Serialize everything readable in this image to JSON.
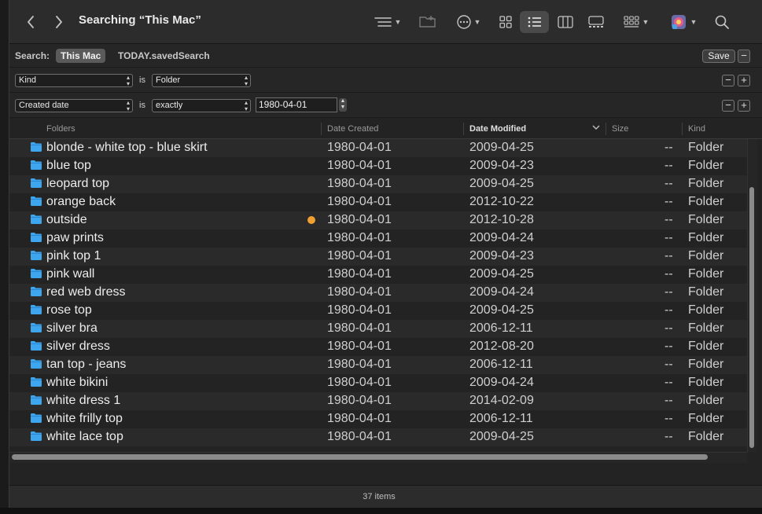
{
  "window": {
    "title": "Searching “This Mac”"
  },
  "toolbar": {
    "icons": [
      "back-chevron-icon",
      "forward-chevron-icon",
      "list-group-icon",
      "new-folder-icon",
      "more-actions-icon",
      "icon-view-icon",
      "list-view-icon",
      "column-view-icon",
      "gallery-view-icon",
      "group-by-icon",
      "app-tag-icon",
      "search-icon"
    ]
  },
  "search": {
    "label": "Search:",
    "scope_selected": "This Mac",
    "scope_other": "TODAY.savedSearch",
    "save_label": "Save",
    "remove_label": "−"
  },
  "criteria": [
    {
      "attribute": "Kind",
      "operator_label": "is",
      "value": "Folder"
    },
    {
      "attribute": "Created date",
      "operator_label": "is",
      "value": "exactly",
      "date": "1980-04-01"
    }
  ],
  "columns": {
    "name": "Folders",
    "created": "Date Created",
    "modified": "Date Modified",
    "size": "Size",
    "kind": "Kind"
  },
  "rows": [
    {
      "name": "blonde - white top - blue skirt",
      "created": "1980-04-01",
      "modified": "2009-04-25",
      "size": "--",
      "kind": "Folder"
    },
    {
      "name": "blue top",
      "created": "1980-04-01",
      "modified": "2009-04-23",
      "size": "--",
      "kind": "Folder"
    },
    {
      "name": "leopard top",
      "created": "1980-04-01",
      "modified": "2009-04-25",
      "size": "--",
      "kind": "Folder"
    },
    {
      "name": "orange back",
      "created": "1980-04-01",
      "modified": "2012-10-22",
      "size": "--",
      "kind": "Folder"
    },
    {
      "name": "outside",
      "created": "1980-04-01",
      "modified": "2012-10-28",
      "size": "--",
      "kind": "Folder",
      "tag_color": "#f0a030"
    },
    {
      "name": "paw prints",
      "created": "1980-04-01",
      "modified": "2009-04-24",
      "size": "--",
      "kind": "Folder"
    },
    {
      "name": "pink top 1",
      "created": "1980-04-01",
      "modified": "2009-04-23",
      "size": "--",
      "kind": "Folder"
    },
    {
      "name": "pink wall",
      "created": "1980-04-01",
      "modified": "2009-04-25",
      "size": "--",
      "kind": "Folder"
    },
    {
      "name": "red web dress",
      "created": "1980-04-01",
      "modified": "2009-04-24",
      "size": "--",
      "kind": "Folder"
    },
    {
      "name": "rose top",
      "created": "1980-04-01",
      "modified": "2009-04-25",
      "size": "--",
      "kind": "Folder"
    },
    {
      "name": "silver bra",
      "created": "1980-04-01",
      "modified": "2006-12-11",
      "size": "--",
      "kind": "Folder"
    },
    {
      "name": "silver dress",
      "created": "1980-04-01",
      "modified": "2012-08-20",
      "size": "--",
      "kind": "Folder"
    },
    {
      "name": "tan top - jeans",
      "created": "1980-04-01",
      "modified": "2006-12-11",
      "size": "--",
      "kind": "Folder"
    },
    {
      "name": "white bikini",
      "created": "1980-04-01",
      "modified": "2009-04-24",
      "size": "--",
      "kind": "Folder"
    },
    {
      "name": "white dress 1",
      "created": "1980-04-01",
      "modified": "2014-02-09",
      "size": "--",
      "kind": "Folder"
    },
    {
      "name": "white frilly top",
      "created": "1980-04-01",
      "modified": "2006-12-11",
      "size": "--",
      "kind": "Folder"
    },
    {
      "name": "white lace top",
      "created": "1980-04-01",
      "modified": "2009-04-25",
      "size": "--",
      "kind": "Folder"
    }
  ],
  "status": {
    "item_count": "37 items"
  },
  "colors": {
    "folder_blue": "#3ea6ef",
    "tag_orange": "#f0a030"
  }
}
